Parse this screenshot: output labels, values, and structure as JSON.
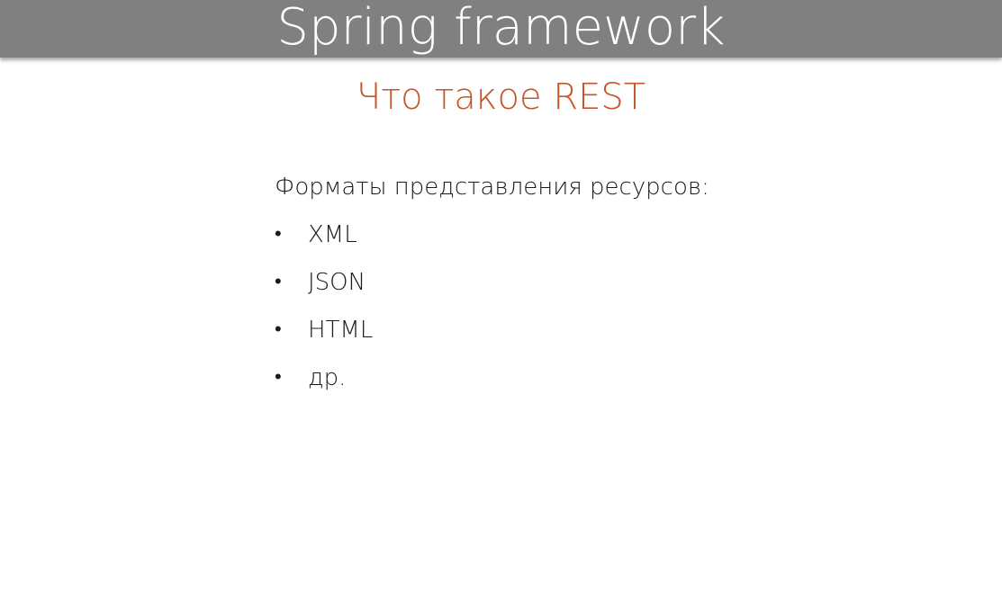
{
  "slide": {
    "title": "Spring framework",
    "subtitle": "Что такое REST",
    "lead": "Форматы представления ресурсов:",
    "bullet_glyph": "•",
    "items": [
      {
        "label": "XML"
      },
      {
        "label": "JSON"
      },
      {
        "label": "HTML"
      },
      {
        "label": "др."
      }
    ]
  },
  "colors": {
    "title_bar": "#808080",
    "title_text": "#ffffff",
    "subtitle_text": "#c5562a",
    "body_text": "#1a1a1a"
  }
}
